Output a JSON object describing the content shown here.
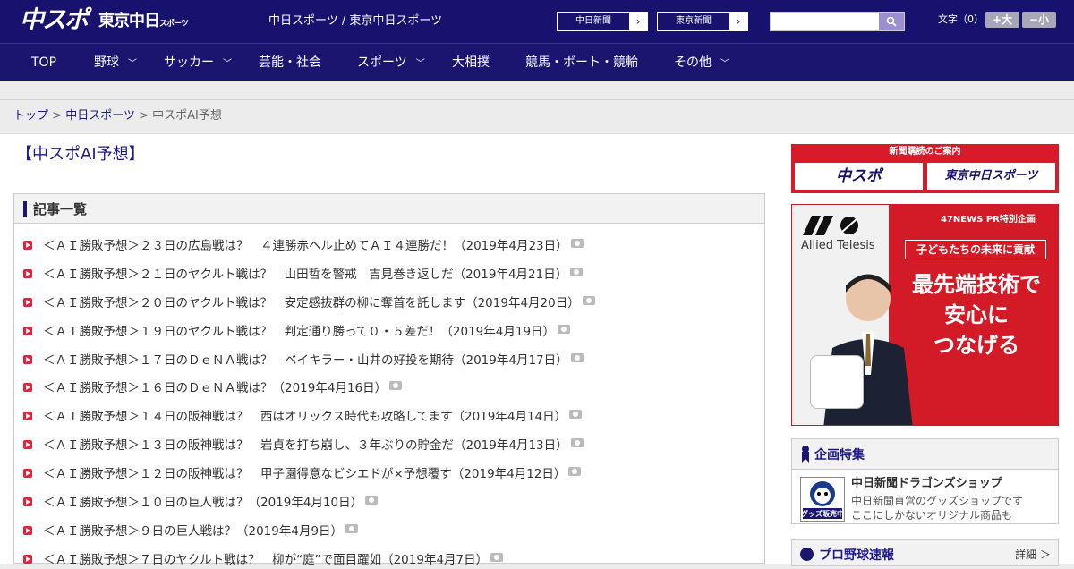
{
  "header": {
    "logo_main": "中スポ",
    "logo_tokyo": "東京中日",
    "logo_tokyo_small": "スポーツ",
    "site_title": "中日スポーツ / 東京中日スポーツ",
    "paper_links": [
      {
        "label": "中日新聞"
      },
      {
        "label": "東京新聞"
      }
    ],
    "search_placeholder": "",
    "fontsize_label": "文字（0）",
    "fontsize_bigger": "+大",
    "fontsize_smaller": "−小"
  },
  "nav": {
    "items": [
      {
        "label": "TOP",
        "has_dropdown": false
      },
      {
        "label": "野球",
        "has_dropdown": true
      },
      {
        "label": "サッカー",
        "has_dropdown": true
      },
      {
        "label": "芸能・社会",
        "has_dropdown": false
      },
      {
        "label": "スポーツ",
        "has_dropdown": true
      },
      {
        "label": "大相撲",
        "has_dropdown": false
      },
      {
        "label": "競馬・ボート・競輪",
        "has_dropdown": false
      },
      {
        "label": "その他",
        "has_dropdown": true
      }
    ]
  },
  "breadcrumb": {
    "home": "トップ",
    "section": "中日スポーツ",
    "current": "中スポAI予想",
    "separator": ">"
  },
  "page_title": "【中スポAI予想】",
  "article_list": {
    "heading": "記事一覧",
    "items": [
      {
        "title": "＜ＡＩ勝敗予想＞２３日の広島戦は？　４連勝赤ヘル止めてＡＩ４連勝だ！（2019年4月23日）"
      },
      {
        "title": "＜ＡＩ勝敗予想＞２１日のヤクルト戦は？　山田哲を警戒　吉見巻き返しだ（2019年4月21日）"
      },
      {
        "title": "＜ＡＩ勝敗予想＞２０日のヤクルト戦は？　安定感抜群の柳に奪首を託します（2019年4月20日）"
      },
      {
        "title": "＜ＡＩ勝敗予想＞１９日のヤクルト戦は？　判定通り勝って０・５差だ！（2019年4月19日）"
      },
      {
        "title": "＜ＡＩ勝敗予想＞１７日のＤｅＮＡ戦は？　ベイキラー・山井の好投を期待（2019年4月17日）"
      },
      {
        "title": "＜ＡＩ勝敗予想＞１６日のＤｅＮＡ戦は？（2019年4月16日）"
      },
      {
        "title": "＜ＡＩ勝敗予想＞１４日の阪神戦は？　西はオリックス時代も攻略してます（2019年4月14日）"
      },
      {
        "title": "＜ＡＩ勝敗予想＞１３日の阪神戦は？　岩貞を打ち崩し、３年ぶりの貯金だ（2019年4月13日）"
      },
      {
        "title": "＜ＡＩ勝敗予想＞１２日の阪神戦は？　甲子園得意なビシエドが×予想覆す（2019年4月12日）"
      },
      {
        "title": "＜ＡＩ勝敗予想＞１０日の巨人戦は？（2019年4月10日）"
      },
      {
        "title": "＜ＡＩ勝敗予想＞９日の巨人戦は？（2019年4月9日）"
      },
      {
        "title": "＜ＡＩ勝敗予想＞７日のヤクルト戦は？　柳が“庭”で面目躍如（2019年4月7日）"
      }
    ]
  },
  "subscription": {
    "heading": "新聞購読のご案内",
    "logos": [
      "中スポ",
      "東京中日スポーツ"
    ]
  },
  "ad": {
    "brand": "Allied Telesis",
    "pr": "47NEWS PR特別企画",
    "tagline": "子どもたちの未来に貢献",
    "copy_lines": [
      "最先端技術で",
      "安心に",
      "つなげる"
    ]
  },
  "feature": {
    "heading": "企画特集",
    "shop_title": "中日新聞ドラゴンズショップ",
    "shop_desc1": "中日新聞直営のグッズショップです",
    "shop_desc2": "ここにしかないオリジナル商品も",
    "thumb_label": "グッズ販売中"
  },
  "pro_baseball": {
    "heading": "プロ野球速報",
    "more": "詳細 ＞"
  },
  "colors": {
    "navy": "#16126e",
    "accent_red": "#d91a2b",
    "link": "#1d1a8a"
  }
}
